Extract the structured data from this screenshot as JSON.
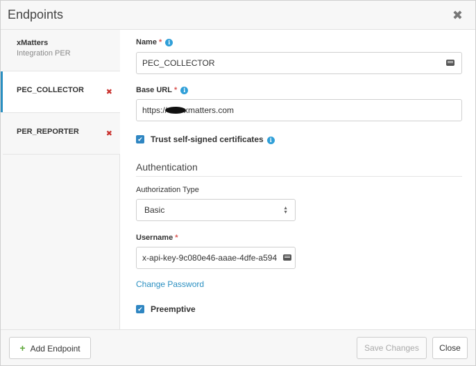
{
  "dialog": {
    "title": "Endpoints",
    "close_symbol": "✖"
  },
  "sidebar": {
    "items": [
      {
        "name": "xMatters",
        "subtitle": "Integration PER"
      },
      {
        "name": "PEC_COLLECTOR",
        "remove_symbol": "✖"
      },
      {
        "name": "PER_REPORTER",
        "remove_symbol": "✖"
      }
    ]
  },
  "form": {
    "name": {
      "label": "Name",
      "required": "*",
      "value": "PEC_COLLECTOR"
    },
    "base_url": {
      "label": "Base URL",
      "required": "*",
      "value_prefix": "https://",
      "value_suffix": "xmatters.com"
    },
    "trust_self_signed": {
      "label": "Trust self-signed certificates",
      "checked": true
    },
    "authentication": {
      "heading": "Authentication",
      "auth_type": {
        "label": "Authorization Type",
        "value": "Basic"
      },
      "username": {
        "label": "Username",
        "required": "*",
        "value": "x-api-key-9c080e46-aaae-4dfe-a594"
      },
      "change_password": "Change Password",
      "preemptive": {
        "label": "Preemptive",
        "checked": true
      }
    },
    "info_symbol": "i",
    "check_symbol": "✔"
  },
  "footer": {
    "add_endpoint": "Add Endpoint",
    "add_symbol": "+",
    "save_changes": "Save Changes",
    "close": "Close"
  },
  "colors": {
    "accent": "#2a8fc1",
    "remove": "#c9302c",
    "add": "#5fa83a"
  },
  "icons": {
    "close": "close-icon",
    "remove": "remove-icon",
    "info": "info-icon",
    "keyboard": "keyboard-icon",
    "select": "select-arrows-icon",
    "add": "plus-icon"
  }
}
